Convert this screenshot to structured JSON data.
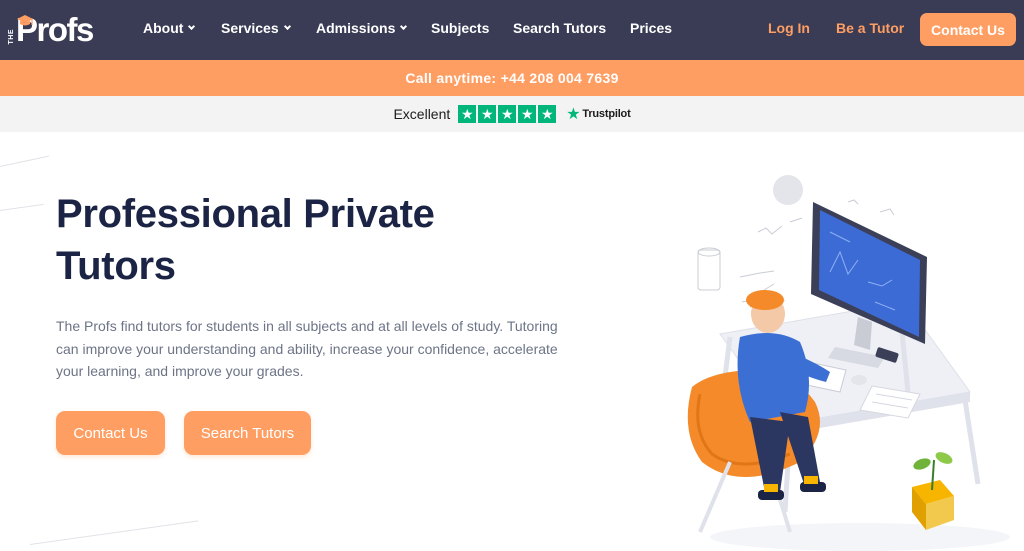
{
  "brand": {
    "logo_prefix": "THE",
    "logo_word": "Profs"
  },
  "nav": {
    "items": [
      {
        "label": "About",
        "dropdown": true
      },
      {
        "label": "Services",
        "dropdown": true
      },
      {
        "label": "Admissions",
        "dropdown": true
      },
      {
        "label": "Subjects",
        "dropdown": false
      },
      {
        "label": "Search Tutors",
        "dropdown": false
      },
      {
        "label": "Prices",
        "dropdown": false
      }
    ],
    "login": "Log In",
    "be_tutor": "Be a Tutor",
    "contact": "Contact Us"
  },
  "banner": {
    "text": "Call anytime: +44 208 004 7639"
  },
  "trustpilot": {
    "rating_word": "Excellent",
    "stars": 5,
    "brand": "Trustpilot"
  },
  "hero": {
    "title": "Professional Private Tutors",
    "description": "The Profs find tutors for students in all subjects and at all levels of study. Tutoring can improve your understanding and ability, increase your confidence, accelerate your learning, and improve your grades.",
    "primary_button": "Contact Us",
    "secondary_button": "Search Tutors"
  },
  "colors": {
    "nav_bg": "#3a3c55",
    "accent": "#ff9e63",
    "title": "#1b2444",
    "body_text": "#6c7486",
    "trustpilot_green": "#00b67a"
  },
  "icons": [
    "graduation-cap-icon",
    "chevron-down-icon",
    "trustpilot-star-icon",
    "student-at-desk-illustration"
  ]
}
